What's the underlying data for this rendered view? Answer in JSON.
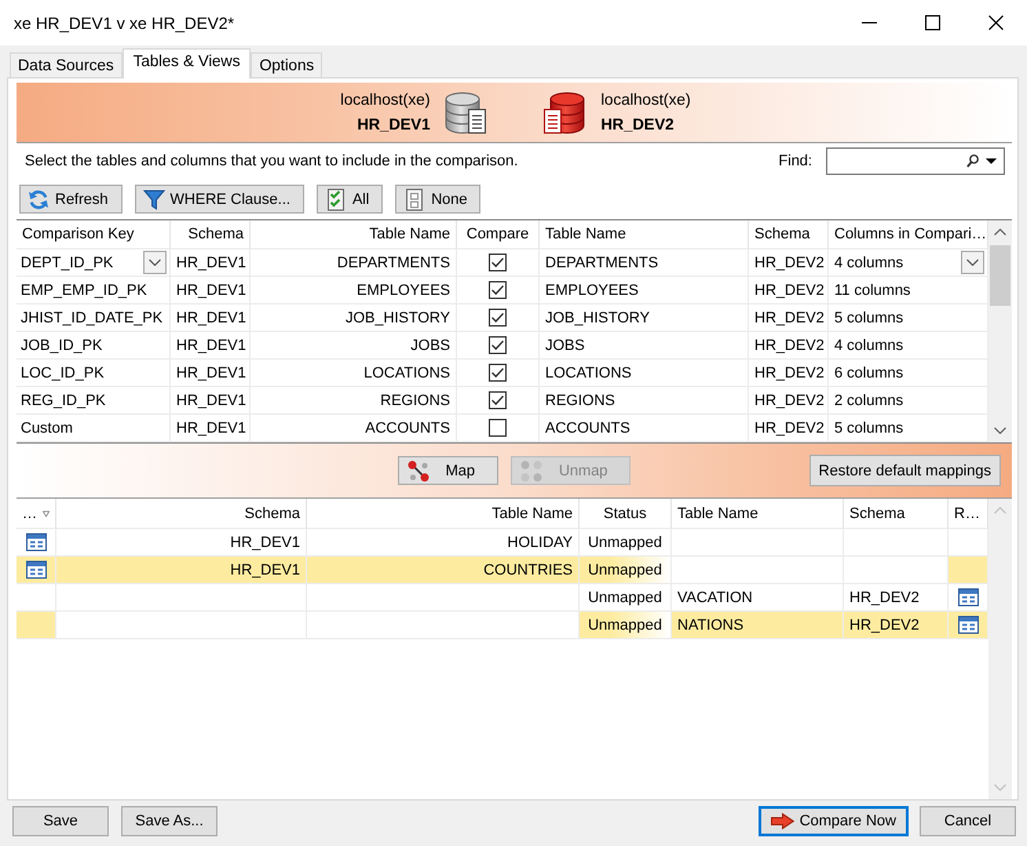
{
  "window": {
    "title": "xe HR_DEV1 v xe HR_DEV2*"
  },
  "tabs": [
    {
      "label": "Data Sources",
      "selected": false
    },
    {
      "label": "Tables & Views",
      "selected": true
    },
    {
      "label": "Options",
      "selected": false
    }
  ],
  "connections": [
    {
      "kind": "source",
      "host": "localhost(xe)",
      "schema": "HR_DEV1"
    },
    {
      "kind": "target",
      "host": "localhost(xe)",
      "schema": "HR_DEV2"
    }
  ],
  "instruction": "Select the tables and columns that you want to include in the comparison.",
  "find": {
    "label": "Find:"
  },
  "toolbar": [
    {
      "kind": "refresh",
      "label": "Refresh"
    },
    {
      "kind": "filter",
      "label": "WHERE Clause..."
    },
    {
      "kind": "all",
      "label": "All"
    },
    {
      "kind": "none",
      "label": "None"
    }
  ],
  "tables": {
    "columns": [
      "Comparison Key",
      "Schema",
      "Table Name",
      "Compare",
      "Table Name",
      "Schema",
      "Columns in Compari…"
    ],
    "rows": [
      {
        "key": "DEPT_ID_PK",
        "source_schema": "HR_DEV1",
        "source_table": "DEPARTMENTS",
        "compare": true,
        "target_table": "DEPARTMENTS",
        "target_schema": "HR_DEV2",
        "columns": "4 columns",
        "focused": true
      },
      {
        "key": "EMP_EMP_ID_PK",
        "source_schema": "HR_DEV1",
        "source_table": "EMPLOYEES",
        "compare": true,
        "target_table": "EMPLOYEES",
        "target_schema": "HR_DEV2",
        "columns": "11 columns",
        "focused": false
      },
      {
        "key": "JHIST_ID_DATE_PK",
        "source_schema": "HR_DEV1",
        "source_table": "JOB_HISTORY",
        "compare": true,
        "target_table": "JOB_HISTORY",
        "target_schema": "HR_DEV2",
        "columns": "5 columns",
        "focused": false
      },
      {
        "key": "JOB_ID_PK",
        "source_schema": "HR_DEV1",
        "source_table": "JOBS",
        "compare": true,
        "target_table": "JOBS",
        "target_schema": "HR_DEV2",
        "columns": "4 columns",
        "focused": false
      },
      {
        "key": "LOC_ID_PK",
        "source_schema": "HR_DEV1",
        "source_table": "LOCATIONS",
        "compare": true,
        "target_table": "LOCATIONS",
        "target_schema": "HR_DEV2",
        "columns": "6 columns",
        "focused": false
      },
      {
        "key": "REG_ID_PK",
        "source_schema": "HR_DEV1",
        "source_table": "REGIONS",
        "compare": true,
        "target_table": "REGIONS",
        "target_schema": "HR_DEV2",
        "columns": "2 columns",
        "focused": false
      },
      {
        "key": "Custom",
        "source_schema": "HR_DEV1",
        "source_table": "ACCOUNTS",
        "compare": false,
        "target_table": "ACCOUNTS",
        "target_schema": "HR_DEV2",
        "columns": "5 columns",
        "focused": false
      }
    ]
  },
  "mapping_buttons": [
    {
      "kind": "map",
      "label": "Map",
      "disabled": false
    },
    {
      "kind": "unmap",
      "label": "Unmap",
      "disabled": true
    }
  ],
  "restore_button": {
    "label": "Restore default mappings"
  },
  "unmapped": {
    "columns": [
      "…",
      "Schema",
      "Table Name",
      "Status",
      "Table Name",
      "Schema",
      "R…"
    ],
    "rows": [
      {
        "source_icon": true,
        "source_schema": "HR_DEV1",
        "source_table": "HOLIDAY",
        "status": "Unmapped",
        "target_icon": false,
        "selected": false
      },
      {
        "source_icon": true,
        "source_schema": "HR_DEV1",
        "source_table": "COUNTRIES",
        "status": "Unmapped",
        "target_icon": false,
        "selected": true
      },
      {
        "source_icon": false,
        "status": "Unmapped",
        "target_table": "VACATION",
        "target_schema": "HR_DEV2",
        "target_icon": true,
        "selected": false
      },
      {
        "source_icon": false,
        "status": "Unmapped",
        "target_table": "NATIONS",
        "target_schema": "HR_DEV2",
        "target_icon": true,
        "selected": true
      }
    ]
  },
  "footer": {
    "left_buttons": [
      {
        "kind": "plain",
        "label": "Save",
        "default": false
      },
      {
        "kind": "plain",
        "label": "Save As...",
        "default": false
      }
    ],
    "right_buttons": [
      {
        "kind": "action",
        "label": "Compare Now",
        "default": true
      },
      {
        "kind": "plain",
        "label": "Cancel",
        "default": false
      }
    ]
  }
}
